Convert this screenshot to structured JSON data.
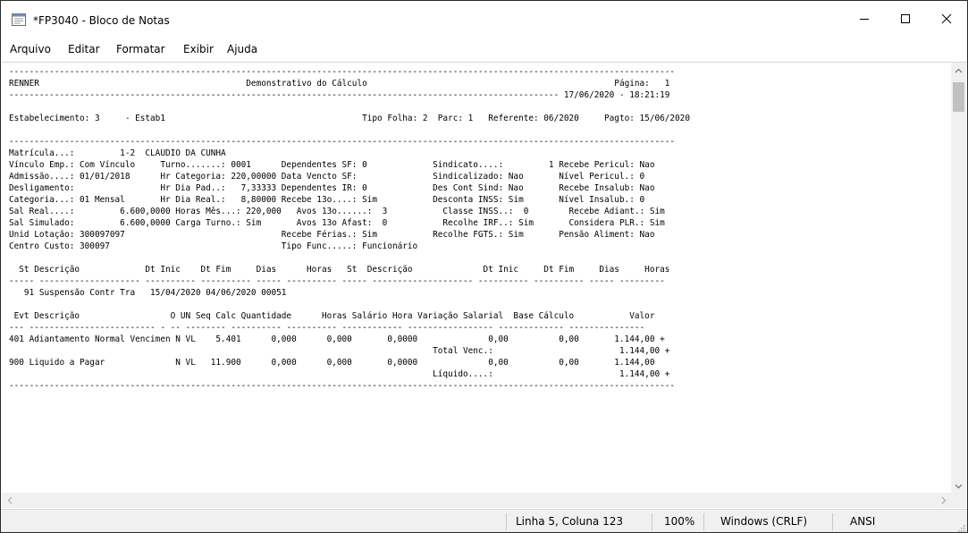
{
  "window": {
    "title": "*FP3040 - Bloco de Notas"
  },
  "menu": {
    "items": [
      "Arquivo",
      "Editar",
      "Formatar",
      "Exibir",
      "Ajuda"
    ]
  },
  "document": {
    "text": "------------------------------------------------------------------------------------------------------------------------------------\nRENNER                                         Demonstrativo do Cálculo                                                 Página:   1\n------------------------------------------------------------------------------------------------------------- 17/06/2020 - 18:21:19\n\nEstabelecimento: 3     - Estab1                                       Tipo Folha: 2  Parc: 1   Referente: 06/2020     Pagto: 15/06/2020\n\n------------------------------------------------------------------------------------------------------------------------------------\nMatrícula...:         1-2  CLAUDIO DA CUNHA\nVínculo Emp.: Com Vínculo     Turno.......: 0001      Dependentes SF: 0             Sindicato....:         1 Recebe Pericul: Nao\nAdmissão....: 01/01/2018      Hr Categoria: 220,00000 Data Vencto SF:               Sindicalizado: Nao       Nível Pericul.: 0\nDesligamento:                 Hr Dia Pad..:   7,33333 Dependentes IR: 0             Des Cont Sind: Nao       Recebe Insalub: Nao\nCategoria...: 01 Mensal       Hr Dia Real.:   8,80000 Recebe 13o....: Sim           Desconta INSS: Sim       Nível Insalub.: 0\nSal Real....:         6.600,0000 Horas Mês...: 220,000   Avos 13o......:  3           Classe INSS..:  0        Recebe Adiant.: Sim\nSal Simulado:         6.600,0000 Carga Turno.: Sim       Avos 13o Afast:  0           Recolhe IRF..: Sim       Considera PLR.: Sim\nUnid Lotação: 300097097                               Recebe Férias.: Sim           Recolhe FGTS.: Sim       Pensão Aliment: Nao\nCentro Custo: 300097                                  Tipo Func.....: Funcionário\n\n  St Descrição             Dt Inic    Dt Fim     Dias      Horas   St  Descrição              Dt Inic     Dt Fim     Dias     Horas\n----- -------------------- ---------- ---------- ----- ---------- ----- -------------------- ---------- ---------- ----- ---------\n   91 Suspensão Contr Tra   15/04/2020 04/06/2020 00051\n\n Evt Descrição                  O UN Seq Calc Quantidade      Horas Salário Hora Variação Salarial  Base Cálculo           Valor\n--- ------------------------- - -- -------- ---------- ---------- ------------ ----------------- ------------- ---------------\n401 Adiantamento Normal Vencimen N VL    5.401      0,000      0,000       0,0000              0,00          0,00       1.144,00 +\n                                                                                    Total Venc.:                         1.144,00 +\n900 Liquido a Pagar              N VL   11.900      0,000      0,000       0,0000              0,00          0,00       1.144,00\n                                                                                    Líquido....:                         1.144,00 +\n------------------------------------------------------------------------------------------------------------------------------------"
  },
  "status": {
    "position": "Linha 5, Coluna 123",
    "zoom": "100%",
    "line_ending": "Windows (CRLF)",
    "encoding": "ANSI"
  },
  "icons": {
    "app": "notepad-icon",
    "minimize": "minimize-icon",
    "maximize": "maximize-icon",
    "close": "close-icon"
  }
}
